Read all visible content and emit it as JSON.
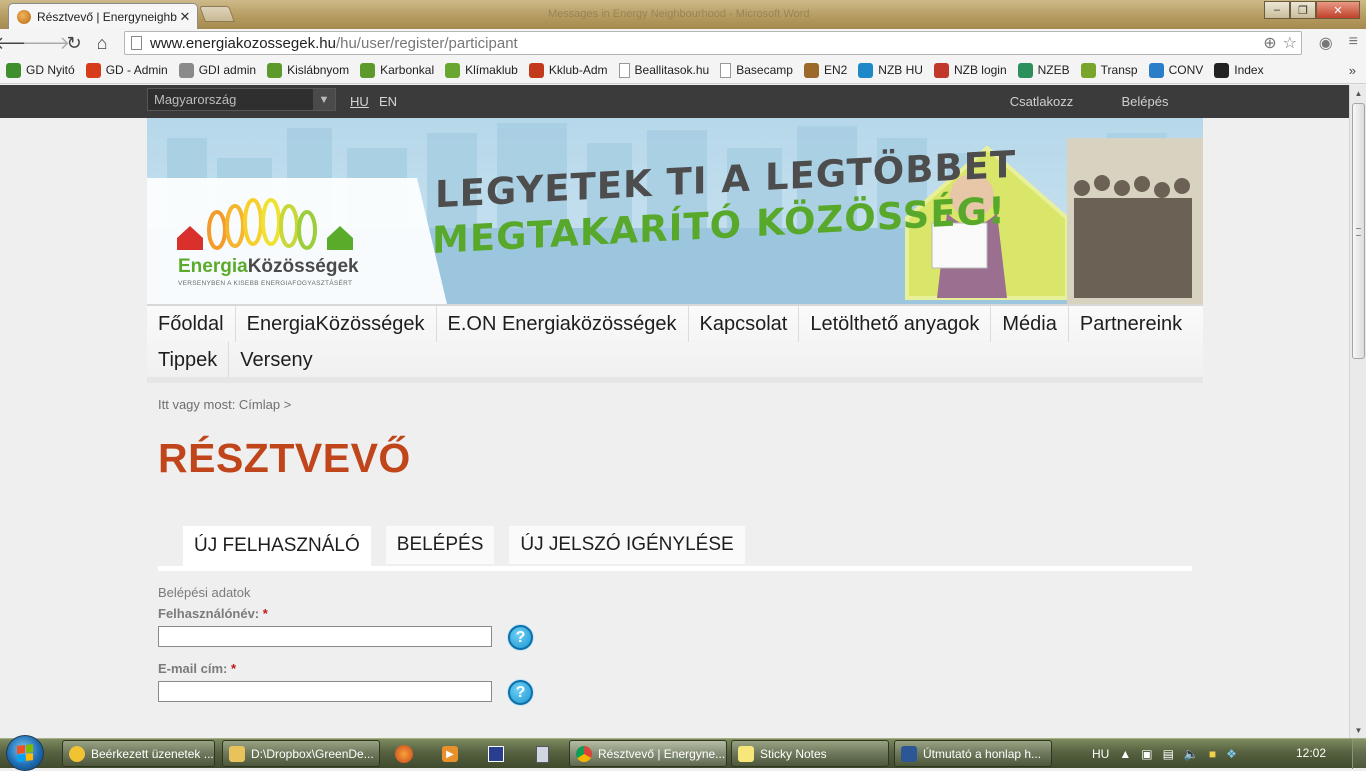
{
  "browser": {
    "tab_title": "Résztvevő | Energyneighbo",
    "faded_window_title": "Messages in Energy Neighbourhood - Microsoft Word",
    "url_host": "www.energiakozossegek.hu",
    "url_path": "/hu/user/register/participant",
    "bookmarks": [
      "GD Nyitó",
      "GD - Admin",
      "GDI admin",
      "Kislábnyom",
      "Karbonkal",
      "Klímaklub",
      "Kklub-Adm",
      "Beallitasok.hu",
      "Basecamp",
      "EN2",
      "NZB HU",
      "NZB login",
      "NZEB",
      "Transp",
      "CONV",
      "Index"
    ],
    "bookmark_colors": [
      "#3f8f2d",
      "#d63b1a",
      "#8a8a8a",
      "#5c9a2c",
      "#5c9a2c",
      "#68a62f",
      "#c23a1b",
      "#ffffff",
      "#ffffff",
      "#9b6a2a",
      "#1e88c9",
      "#c0392b",
      "#2c8f5c",
      "#7aa52c",
      "#2a7ec7",
      "#222222"
    ]
  },
  "site": {
    "country_select": "Magyarország",
    "lang_hu": "HU",
    "lang_en": "EN",
    "join_button": "Csatlakozz",
    "login_button": "Belépés",
    "logo_green": "Energia",
    "logo_dark": "Közösségek",
    "logo_sub": "VERSENYBEN A KISEBB ENERGIAFOGYASZTÁSÉRT",
    "slogan_line1": "LEGYETEK TI A LEGTÖBBET",
    "slogan_line2": "MEGTAKARÍTÓ KÖZÖSSÉG!",
    "nav_row1": [
      "Főoldal",
      "EnergiaKözösségek",
      "E.ON Energiaközösségek",
      "Kapcsolat",
      "Letölthető anyagok",
      "Média",
      "Partnereink"
    ],
    "nav_row2": [
      "Tippek",
      "Verseny"
    ],
    "breadcrumb": "Itt vagy most: Címlap >",
    "page_title": "RÉSZTVEVŐ",
    "tabs": [
      "ÚJ FELHASZNÁLÓ",
      "BELÉPÉS",
      "ÚJ JELSZÓ IGÉNYLÉSE"
    ],
    "fieldset_legend": "Belépési adatok",
    "username_label": "Felhasználónév:",
    "email_label": "E-mail cím:",
    "required_mark": "*",
    "help_symbol": "?"
  },
  "taskbar": {
    "items": [
      "Beérkezett üzenetek ...",
      "D:\\Dropbox\\GreenDe...",
      "Résztvevő | Energyne...",
      "Sticky Notes",
      "Útmutató a honlap h..."
    ],
    "lang": "HU",
    "clock": "12:02"
  },
  "colors": {
    "accent_title": "#c1451a",
    "topbar": "#3b3b3b",
    "logo_green": "#5bab2b"
  }
}
